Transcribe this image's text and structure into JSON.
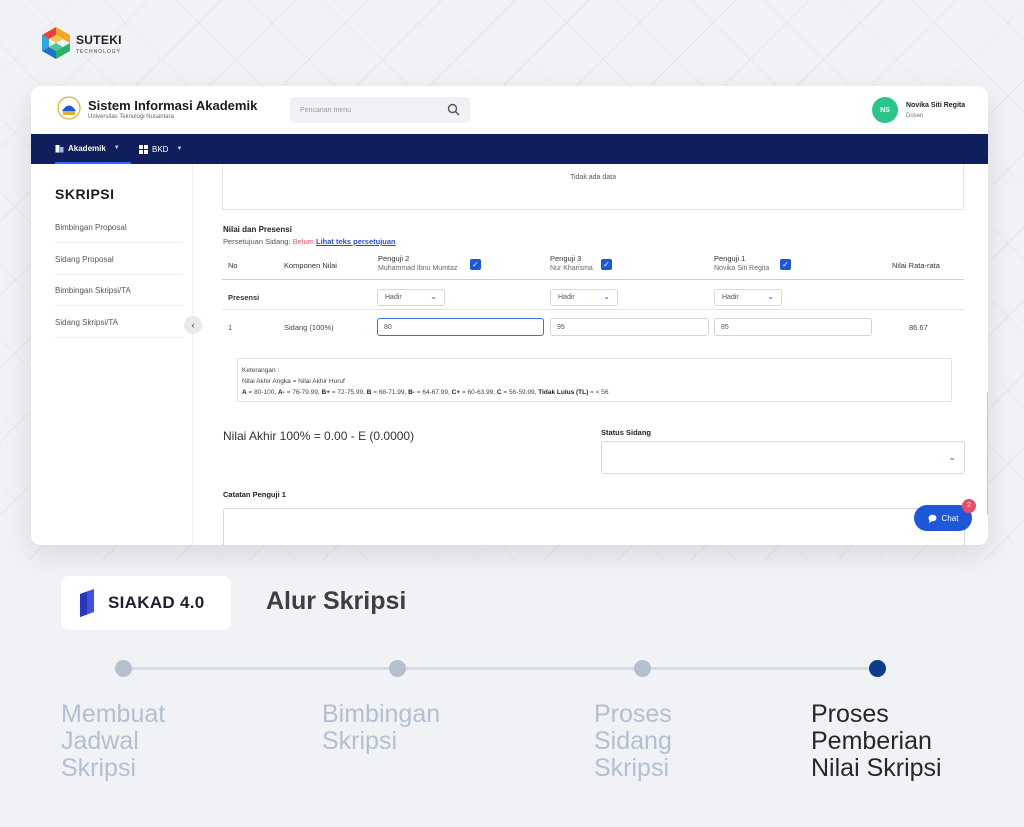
{
  "brand": {
    "name": "SUTEKI",
    "sub": "TECHNOLOGY"
  },
  "app": {
    "title": "Sistem Informasi Akademik",
    "subtitle": "Universitas Teknologi Nusantara",
    "search_placeholder": "Pencarian menu",
    "user": {
      "initials": "NS",
      "name": "Novika Siti Regita",
      "role": "Dosen"
    }
  },
  "nav": [
    {
      "label": "Akademik"
    },
    {
      "label": "BKD"
    }
  ],
  "sidebar": {
    "title": "SKRIPSI",
    "items": [
      {
        "label": "Bimbingan Proposal"
      },
      {
        "label": "Sidang Proposal"
      },
      {
        "label": "Bimbingan Skripsi/TA"
      },
      {
        "label": "Sidang Skripsi/TA"
      }
    ]
  },
  "main": {
    "empty_text": "Tidak ada data",
    "section_title": "Nilai dan Presensi",
    "approval_label": "Persetujuan Sidang:",
    "approval_status": "Belum",
    "approval_link": "Lihat teks persetujuan",
    "table": {
      "col_no": "No",
      "col_component": "Komponen Nilai",
      "col_avg": "Nilai Rata-rata",
      "examiners": [
        {
          "label": "Penguji 2",
          "name": "Muhammad Ibnu Mumtaz"
        },
        {
          "label": "Penguji 3",
          "name": "Nur Kharisma"
        },
        {
          "label": "Penguji 1",
          "name": "Novika Siti Regita"
        }
      ],
      "presence_label": "Presensi",
      "presence_values": [
        "Hadir",
        "Hadir",
        "Hadir"
      ],
      "row": {
        "no": "1",
        "component": "Sidang (100%)",
        "scores": [
          "80",
          "95",
          "85"
        ],
        "average": "86.67"
      }
    },
    "legend": {
      "line1": "Keterangan :",
      "line2": "Nilai Akhir Angka = Nilai Akhir Huruf",
      "line3": [
        {
          "g": "A",
          "r": " = 80-100, "
        },
        {
          "g": "A-",
          "r": " = 76-79.99, "
        },
        {
          "g": "B+",
          "r": " = 72-75.99, "
        },
        {
          "g": "B",
          "r": " = 68-71.99, "
        },
        {
          "g": "B-",
          "r": " = 64-67.99, "
        },
        {
          "g": "C+",
          "r": " = 60-63.99, "
        },
        {
          "g": "C",
          "r": " = 56-59.99, "
        },
        {
          "g": "Tidak Lulus (TL)",
          "r": " = < 56"
        }
      ]
    },
    "final_score": "Nilai Akhir 100% = 0.00 - E (0.0000)",
    "status_label": "Status Sidang",
    "note_label": "Catatan Penguji 1",
    "chat_label": "Chat",
    "chat_badge": "2"
  },
  "footer": {
    "product": "SIAKAD 4.0",
    "flow_title": "Alur Skripsi",
    "steps": [
      {
        "line1": "Membuat",
        "line2": "Jadwal",
        "line3": "Skripsi"
      },
      {
        "line1": "Bimbingan",
        "line2": "Skripsi",
        "line3": ""
      },
      {
        "line1": "Proses",
        "line2": "Sidang",
        "line3": "Skripsi"
      },
      {
        "line1": "Proses",
        "line2": "Pemberian",
        "line3": "Nilai Skripsi"
      }
    ]
  },
  "colors": {
    "navbar": "#0e1f5b",
    "accent": "#1f58d6",
    "avatar": "#2bc48a",
    "active_step": "#0e3c86"
  }
}
